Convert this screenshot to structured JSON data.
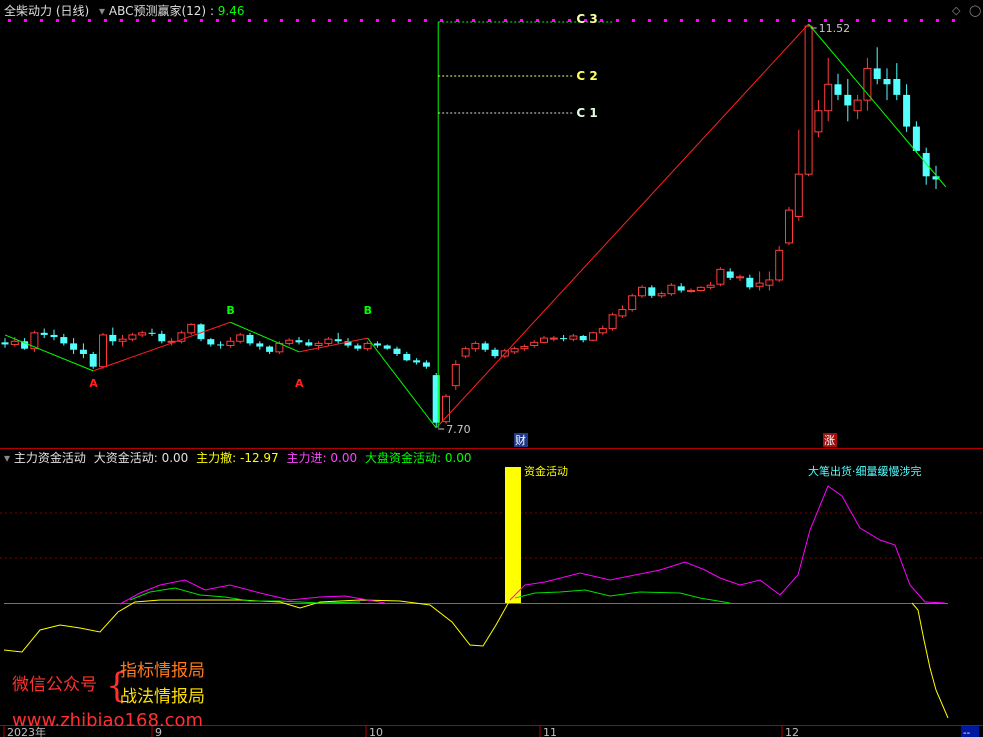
{
  "header": {
    "title": "全柴动力 (日线)",
    "indicator_name": "ABC预测赢家(12)",
    "indicator_sep": " : ",
    "indicator_value": "9.46"
  },
  "lower_header": {
    "name": "主力资金活动",
    "big_label": "大资金活动:",
    "big_value": "0.00",
    "scatter_label": "主力撤:",
    "scatter_value": "-12.97",
    "in_label": "主力进:",
    "in_value": "0.00",
    "market_label": "大盘资金活动:",
    "market_value": "0.00",
    "bar_caption": "资金活动",
    "top_caption": "大笔出货·细量缓慢涉完"
  },
  "labels": {
    "high": "11.52",
    "low": "7.70",
    "c2": "C 2",
    "c1": "C 1",
    "c3": "C 3",
    "cai": "财",
    "zhang": "涨",
    "a": "A",
    "b": "B"
  },
  "xaxis": {
    "ticks": [
      "2023年",
      "9",
      "10",
      "11",
      "12"
    ],
    "corner": "--"
  },
  "watermark": {
    "prefix": "微信公众号",
    "line1": "指标情报局",
    "line2": "战法情报局",
    "url": "www.zhibiao168.com"
  },
  "colors": {
    "up": "#ff3c3c",
    "down": "#54ffff",
    "green": "#00e000",
    "yellow": "#ffff00",
    "magenta": "#ff00ff",
    "grid": "#800000"
  },
  "chart_data": {
    "type": "candlestick",
    "low_price": 7.7,
    "high_price": 11.52,
    "candles": [
      [
        8.51,
        8.55,
        8.46,
        8.49
      ],
      [
        8.49,
        8.56,
        8.47,
        8.52
      ],
      [
        8.52,
        8.55,
        8.44,
        8.45
      ],
      [
        8.45,
        8.62,
        8.42,
        8.6
      ],
      [
        8.6,
        8.64,
        8.55,
        8.58
      ],
      [
        8.58,
        8.63,
        8.53,
        8.56
      ],
      [
        8.56,
        8.59,
        8.48,
        8.5
      ],
      [
        8.5,
        8.55,
        8.4,
        8.44
      ],
      [
        8.44,
        8.5,
        8.36,
        8.4
      ],
      [
        8.4,
        8.42,
        8.26,
        8.28
      ],
      [
        8.28,
        8.6,
        8.26,
        8.58
      ],
      [
        8.58,
        8.65,
        8.48,
        8.52
      ],
      [
        8.52,
        8.58,
        8.47,
        8.54
      ],
      [
        8.54,
        8.6,
        8.52,
        8.58
      ],
      [
        8.58,
        8.62,
        8.56,
        8.6
      ],
      [
        8.6,
        8.64,
        8.57,
        8.59
      ],
      [
        8.59,
        8.62,
        8.5,
        8.52
      ],
      [
        8.52,
        8.55,
        8.48,
        8.52
      ],
      [
        8.52,
        8.62,
        8.5,
        8.6
      ],
      [
        8.6,
        8.69,
        8.58,
        8.68
      ],
      [
        8.68,
        8.69,
        8.52,
        8.54
      ],
      [
        8.54,
        8.55,
        8.47,
        8.49
      ],
      [
        8.49,
        8.52,
        8.45,
        8.48
      ],
      [
        8.48,
        8.56,
        8.46,
        8.52
      ],
      [
        8.52,
        8.6,
        8.5,
        8.58
      ],
      [
        8.58,
        8.6,
        8.48,
        8.5
      ],
      [
        8.5,
        8.52,
        8.44,
        8.47
      ],
      [
        8.47,
        8.48,
        8.4,
        8.42
      ],
      [
        8.42,
        8.52,
        8.4,
        8.5
      ],
      [
        8.5,
        8.55,
        8.48,
        8.53
      ],
      [
        8.53,
        8.56,
        8.49,
        8.51
      ],
      [
        8.51,
        8.54,
        8.47,
        8.48
      ],
      [
        8.48,
        8.52,
        8.44,
        8.5
      ],
      [
        8.5,
        8.56,
        8.48,
        8.54
      ],
      [
        8.54,
        8.6,
        8.5,
        8.52
      ],
      [
        8.52,
        8.55,
        8.46,
        8.48
      ],
      [
        8.48,
        8.5,
        8.43,
        8.45
      ],
      [
        8.45,
        8.52,
        8.43,
        8.5
      ],
      [
        8.5,
        8.52,
        8.46,
        8.48
      ],
      [
        8.48,
        8.49,
        8.44,
        8.45
      ],
      [
        8.45,
        8.47,
        8.38,
        8.4
      ],
      [
        8.4,
        8.42,
        8.33,
        8.34
      ],
      [
        8.34,
        8.36,
        8.3,
        8.32
      ],
      [
        8.32,
        8.34,
        8.26,
        8.28
      ],
      [
        8.2,
        8.22,
        7.7,
        7.75
      ],
      [
        7.76,
        8.02,
        7.74,
        8.0
      ],
      [
        8.1,
        8.34,
        8.06,
        8.3
      ],
      [
        8.38,
        8.47,
        8.36,
        8.45
      ],
      [
        8.45,
        8.52,
        8.42,
        8.5
      ],
      [
        8.5,
        8.52,
        8.42,
        8.44
      ],
      [
        8.44,
        8.46,
        8.36,
        8.38
      ],
      [
        8.38,
        8.45,
        8.36,
        8.43
      ],
      [
        8.42,
        8.47,
        8.4,
        8.45
      ],
      [
        8.45,
        8.49,
        8.43,
        8.47
      ],
      [
        8.48,
        8.53,
        8.46,
        8.51
      ],
      [
        8.51,
        8.57,
        8.5,
        8.55
      ],
      [
        8.55,
        8.57,
        8.52,
        8.55
      ],
      [
        8.55,
        8.58,
        8.52,
        8.54
      ],
      [
        8.54,
        8.59,
        8.52,
        8.57
      ],
      [
        8.57,
        8.58,
        8.51,
        8.53
      ],
      [
        8.53,
        8.61,
        8.52,
        8.6
      ],
      [
        8.6,
        8.67,
        8.58,
        8.64
      ],
      [
        8.64,
        8.79,
        8.62,
        8.77
      ],
      [
        8.76,
        8.86,
        8.74,
        8.82
      ],
      [
        8.82,
        8.97,
        8.8,
        8.95
      ],
      [
        8.95,
        9.05,
        8.93,
        9.03
      ],
      [
        9.03,
        9.05,
        8.93,
        8.95
      ],
      [
        8.95,
        8.99,
        8.93,
        8.97
      ],
      [
        8.97,
        9.07,
        8.95,
        9.05
      ],
      [
        9.04,
        9.07,
        8.98,
        9.0
      ],
      [
        9.0,
        9.02,
        8.98,
        9.0
      ],
      [
        9.0,
        9.04,
        8.99,
        9.03
      ],
      [
        9.03,
        9.08,
        9.01,
        9.05
      ],
      [
        9.06,
        9.22,
        9.04,
        9.2
      ],
      [
        9.18,
        9.21,
        9.1,
        9.12
      ],
      [
        9.12,
        9.15,
        9.09,
        9.13
      ],
      [
        9.12,
        9.15,
        9.01,
        9.03
      ],
      [
        9.04,
        9.18,
        9.0,
        9.07
      ],
      [
        9.05,
        9.18,
        9.0,
        9.1
      ],
      [
        9.1,
        9.42,
        9.08,
        9.38
      ],
      [
        9.45,
        9.79,
        9.43,
        9.76
      ],
      [
        9.7,
        10.52,
        9.66,
        10.1
      ],
      [
        10.1,
        11.52,
        10.08,
        11.5
      ],
      [
        10.5,
        10.8,
        10.45,
        10.7
      ],
      [
        10.7,
        11.2,
        10.6,
        10.95
      ],
      [
        10.95,
        11.05,
        10.8,
        10.85
      ],
      [
        10.85,
        11.0,
        10.6,
        10.75
      ],
      [
        10.7,
        10.85,
        10.62,
        10.8
      ],
      [
        10.8,
        11.2,
        10.7,
        11.1
      ],
      [
        11.1,
        11.3,
        10.95,
        11.0
      ],
      [
        11.0,
        11.1,
        10.8,
        10.95
      ],
      [
        11.0,
        11.15,
        10.8,
        10.85
      ],
      [
        10.85,
        10.95,
        10.5,
        10.55
      ],
      [
        10.55,
        10.6,
        10.3,
        10.32
      ],
      [
        10.3,
        10.35,
        10.0,
        10.08
      ],
      [
        10.08,
        10.18,
        9.96,
        10.05
      ]
    ]
  }
}
